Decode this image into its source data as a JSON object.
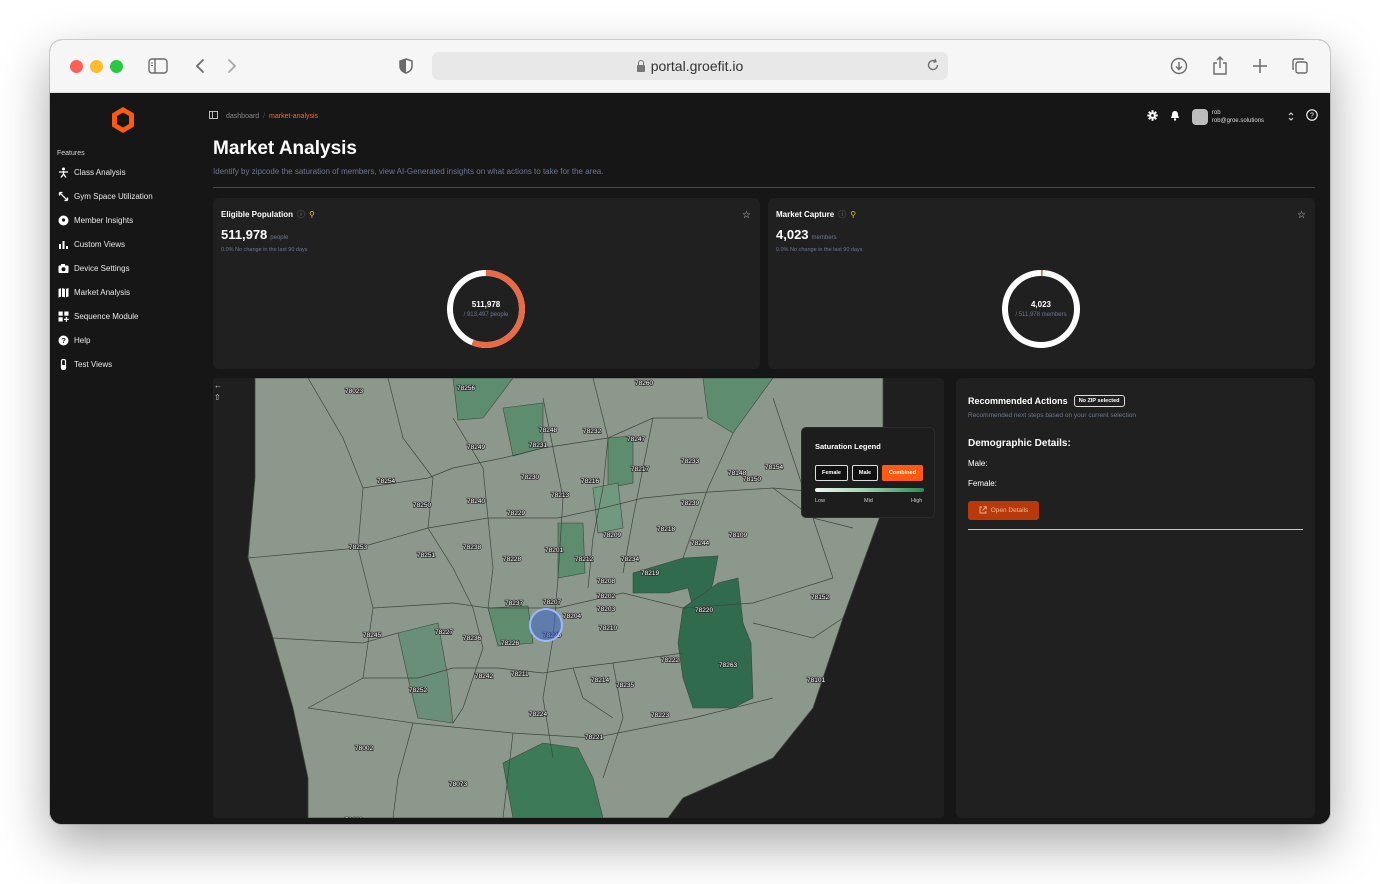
{
  "browser": {
    "url": "portal.groefit.io"
  },
  "sidebar": {
    "section_label": "Features",
    "items": [
      {
        "label": "Class Analysis",
        "icon": "person-exercise-icon"
      },
      {
        "label": "Gym Space Utilization",
        "icon": "resize-arrows-icon"
      },
      {
        "label": "Member Insights",
        "icon": "location-pin-icon"
      },
      {
        "label": "Custom Views",
        "icon": "bar-chart-icon"
      },
      {
        "label": "Device Settings",
        "icon": "camera-icon"
      },
      {
        "label": "Market Analysis",
        "icon": "map-icon"
      },
      {
        "label": "Sequence Module",
        "icon": "grid-plus-icon"
      },
      {
        "label": "Help",
        "icon": "question-circle-icon"
      },
      {
        "label": "Test Views",
        "icon": "test-tube-icon"
      }
    ]
  },
  "header": {
    "breadcrumb": {
      "root": "dashboard",
      "separator": "/",
      "current": "market-analysis"
    },
    "user": {
      "name": "rob",
      "email": "rob@groe.solutions"
    }
  },
  "page": {
    "title": "Market Analysis",
    "subtitle": "Identify by zipcode the saturation of members, view AI-Generated insights on what actions to take for the area."
  },
  "cards": {
    "eligible": {
      "title": "Eligible Population",
      "value": "511,978",
      "unit": "people",
      "change": "0.0% No change in the last 90 days",
      "donut_value": "511,978",
      "donut_sub": "/ 913,497 people",
      "fraction": 0.5605,
      "accent": "#ea6a48"
    },
    "capture": {
      "title": "Market Capture",
      "value": "4,023",
      "unit": "members",
      "change": "0.0% No change in the last 90 days",
      "donut_value": "4,023",
      "donut_sub": "/ 511,978 members",
      "fraction": 0.0079,
      "accent": "#ea6a48"
    }
  },
  "map": {
    "zip_labels": [
      "78023",
      "78256",
      "78260",
      "78248",
      "78232",
      "78247",
      "78249",
      "78231",
      "78233",
      "78254",
      "78230",
      "78216",
      "78217",
      "78148",
      "78154",
      "78150",
      "78250",
      "78240",
      "78213",
      "78239",
      "78229",
      "78209",
      "78218",
      "78244",
      "78109",
      "78253",
      "78251",
      "78238",
      "78228",
      "78201",
      "78212",
      "78234",
      "78219",
      "78208",
      "78202",
      "78203",
      "78220",
      "78152",
      "78237",
      "78207",
      "78204",
      "78210",
      "78245",
      "78227",
      "78236",
      "78226",
      "78225",
      "78222",
      "78263",
      "78242",
      "78211",
      "78214",
      "78235",
      "78101",
      "78252",
      "78224",
      "78223",
      "78221",
      "78002",
      "78073",
      "78112"
    ],
    "selected_zip": "78225",
    "fill_base": "#8d988c",
    "fill_mid": "#5d8c6f",
    "fill_high": "#2f6b4c"
  },
  "legend": {
    "title": "Saturation Legend",
    "buttons": [
      "Female",
      "Male",
      "Combined"
    ],
    "active": "Combined",
    "low": "Low",
    "mid": "Mid",
    "high": "High"
  },
  "recommended": {
    "title": "Recommended Actions",
    "badge": "No ZIP selected",
    "subtitle": "Recommended next steps based on your current selection",
    "demographic_title": "Demographic Details:",
    "male_label": "Male:",
    "female_label": "Female:",
    "button": "Open Details"
  }
}
